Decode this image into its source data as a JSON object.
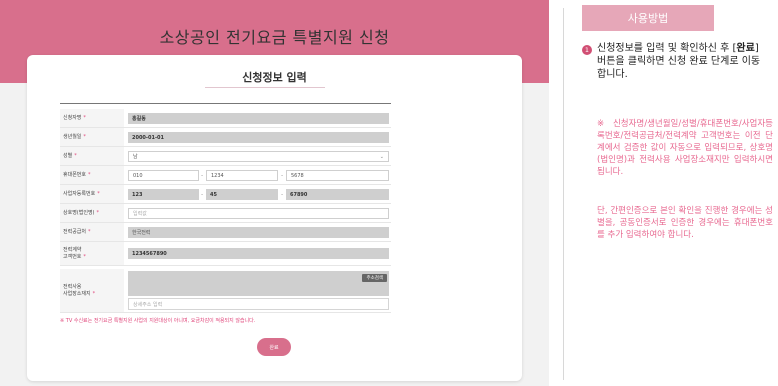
{
  "page": {
    "title": "소상공인 전기요금 특별지원 신청"
  },
  "form": {
    "section_title": "신청정보 입력",
    "required_mark": "*",
    "fields": {
      "applicant": {
        "label": "신청자명",
        "value": "홍길동"
      },
      "birth": {
        "label": "생년월일",
        "value": "2000-01-01"
      },
      "gender": {
        "label": "성별",
        "value": "남"
      },
      "phone": {
        "label": "휴대폰번호",
        "part1": "010",
        "part2": "1234",
        "part3": "5678"
      },
      "bizno": {
        "label": "사업자등록번호",
        "part1": "123",
        "part2": "45",
        "part3": "67890"
      },
      "company": {
        "label": "상호명(법인명)",
        "placeholder": "입력값"
      },
      "supplier": {
        "label": "전력공급처",
        "value": "한국전력"
      },
      "customer_no": {
        "label_line1": "전력계약",
        "label_line2": "고객번호",
        "value": "1234567890"
      },
      "address": {
        "label_line1": "전력사용",
        "label_line2": "사업장소재지",
        "search_button": "주소검색",
        "detail_placeholder": "상세주소 입력"
      }
    },
    "dash": "-",
    "notice": "※ TV 수신료는 전기요금 특별지원 사업의 지원대상이 아니며, 요금차감이 적용되지 않습니다.",
    "submit_label": "완료"
  },
  "usage": {
    "header": "사용방법",
    "step_number": "1",
    "step_text_before": "신청정보를 입력 및 확인하신 후 [",
    "step_text_bold": "완료",
    "step_text_after": "] 버튼을 클릭하면 신청 완료 단계로 이동합니다.",
    "note1": "※ 신청자명/생년월일/성별/휴대폰번호/사업자등록번호/전력공급처/전력계약 고객번호는 이전 단계에서 검증한 값이 자동으로 입력되므로, 상호명(법인명)과 전력사용 사업장소재지만 입력하시면 됩니다.",
    "note2": "단, 간편인증으로 본인 확인을 진행한 경우에는 성별을, 공동인증서로 인증한 경우에는 휴대폰번호를 추가 입력하여야 합니다."
  },
  "colors": {
    "accent": "#d86f8c",
    "required": "#e0457a",
    "note": "#e86a91",
    "usage_header": "#e6a7b8"
  }
}
